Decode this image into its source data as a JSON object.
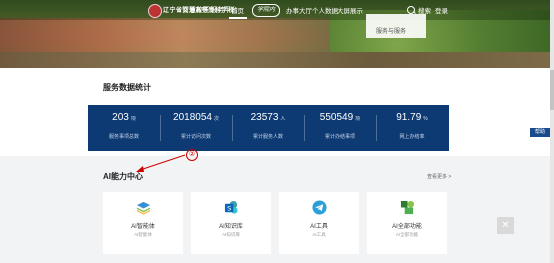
{
  "header": {
    "school_name": "辽宁省交通高等专科学校",
    "platform_name": "智慧校园服务平台",
    "nav": [
      {
        "label": "首页"
      },
      {
        "label": "办事大厅"
      },
      {
        "label": "个人数据"
      },
      {
        "label": "大屏展示"
      }
    ],
    "badge_label": "学院内",
    "search_label": "搜索",
    "login_label": "登录",
    "dropdown_items": [
      "",
      "服务与服务"
    ]
  },
  "stats": {
    "title": "服务数据统计",
    "items": [
      {
        "value": "203",
        "unit": "项",
        "label": "服务事项总数"
      },
      {
        "value": "2018054",
        "unit": "次",
        "label": "累计访问次数"
      },
      {
        "value": "23573",
        "unit": "人",
        "label": "累计服务人数"
      },
      {
        "value": "550549",
        "unit": "项",
        "label": "累计办结事项"
      },
      {
        "value": "91.79",
        "unit": "%",
        "label": "网上办结率"
      }
    ]
  },
  "side_tab_label": "帮助",
  "annotation_number": "②",
  "ai_section": {
    "title": "AI能力中心",
    "more_label": "查看更多 >",
    "cards": [
      {
        "title": "AI智能体",
        "subtitle": "AI智能体",
        "icon": "layers-icon",
        "color": "#3b8fd6"
      },
      {
        "title": "AI知识库",
        "subtitle": "AI知识库",
        "icon": "sharepoint-icon",
        "color": "#0b67b8"
      },
      {
        "title": "AI工具",
        "subtitle": "AI工具",
        "icon": "telegram-icon",
        "color": "#2a9fd8"
      },
      {
        "title": "AI全部功能",
        "subtitle": "AI全部功能",
        "icon": "blocks-icon",
        "color": "#3a8f3a"
      }
    ]
  },
  "close_label": "✕"
}
